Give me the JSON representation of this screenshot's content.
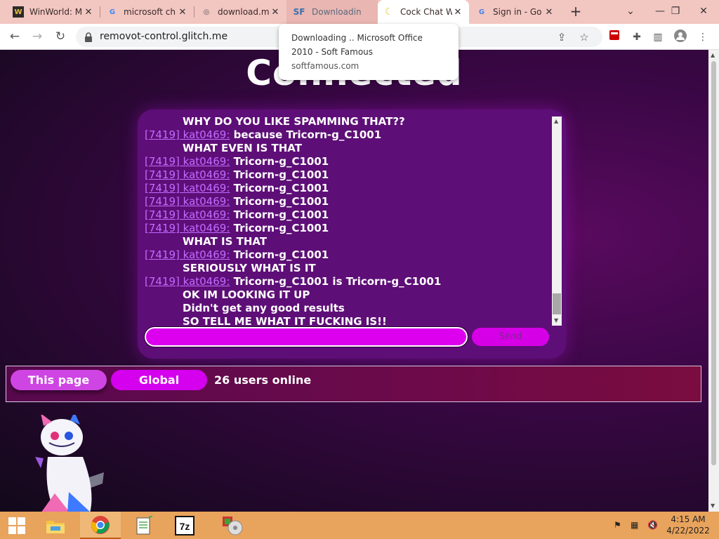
{
  "tabs": [
    {
      "favicon": "W",
      "title": "WinWorld: M",
      "icon": "winworld-icon"
    },
    {
      "favicon": "G",
      "title": "microsoft ch",
      "icon": "google-icon"
    },
    {
      "favicon": "◎",
      "title": "download.m",
      "icon": "globe-icon"
    },
    {
      "favicon": "SF",
      "title": "Downloadin",
      "icon": "softfamous-icon"
    },
    {
      "favicon": "☾",
      "title": "Cock Chat W",
      "icon": "moon-icon"
    },
    {
      "favicon": "G",
      "title": "Sign in - Go",
      "icon": "google-icon"
    }
  ],
  "toolbar": {
    "url": "removot-control.glitch.me"
  },
  "popup": {
    "title": "Downloading .. Microsoft Office 2010 - Soft Famous",
    "domain": "softfamous.com"
  },
  "page": {
    "heading": "Connected",
    "messages": [
      {
        "user": "",
        "text": "WHY DO YOU LIKE SPAMMING THAT??"
      },
      {
        "user": "[7419] kat0469:",
        "text": " because Tricorn-g_C1001"
      },
      {
        "user": "",
        "text": "WHAT EVEN IS THAT"
      },
      {
        "user": "[7419] kat0469:",
        "text": " Tricorn-g_C1001"
      },
      {
        "user": "[7419] kat0469:",
        "text": " Tricorn-g_C1001"
      },
      {
        "user": "[7419] kat0469:",
        "text": " Tricorn-g_C1001"
      },
      {
        "user": "[7419] kat0469:",
        "text": " Tricorn-g_C1001"
      },
      {
        "user": "[7419] kat0469:",
        "text": " Tricorn-g_C1001"
      },
      {
        "user": "[7419] kat0469:",
        "text": " Tricorn-g_C1001"
      },
      {
        "user": "",
        "text": "WHAT IS THAT"
      },
      {
        "user": "[7419] kat0469:",
        "text": " Tricorn-g_C1001"
      },
      {
        "user": "",
        "text": "SERIOUSLY WHAT IS IT"
      },
      {
        "user": "[7419] kat0469:",
        "text": " Tricorn-g_C1001 is Tricorn-g_C1001"
      },
      {
        "user": "",
        "text": "OK IM LOOKING IT UP"
      },
      {
        "user": "",
        "text": "Didn't get any good results"
      },
      {
        "user": "",
        "text": "SO TELL ME WHAT IT FUCKING IS!!"
      }
    ],
    "input_value": "",
    "send_label": "Send",
    "this_page_label": "This page",
    "global_label": "Global",
    "online_text": "26 users online"
  },
  "taskbar": {
    "time": "4:15 AM",
    "date": "4/22/2022",
    "apps": [
      "start-icon",
      "file-explorer-icon",
      "chrome-icon",
      "notepad-icon",
      "7zip-icon",
      "media-icon"
    ]
  },
  "colors": {
    "tabstrip": "#f2c6c1",
    "chat_bg": "#5e0e77",
    "username": "#c06cff",
    "button": "#d400ee",
    "taskbar": "#e8a35c"
  }
}
